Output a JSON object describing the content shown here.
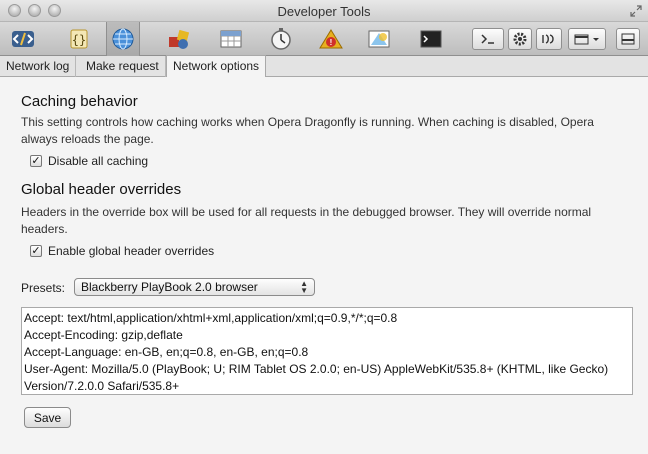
{
  "window": {
    "title": "Developer Tools"
  },
  "toolbar": {
    "panels": [
      {
        "icon": "dom-inspector-icon"
      },
      {
        "icon": "scripts-icon"
      },
      {
        "icon": "network-icon",
        "active": true
      },
      {
        "icon": "resources-icon"
      },
      {
        "icon": "storage-icon"
      },
      {
        "icon": "profiler-icon"
      },
      {
        "icon": "errors-icon"
      },
      {
        "icon": "utilities-icon"
      },
      {
        "icon": "console-icon"
      }
    ],
    "right_buttons": [
      "command-line-icon",
      "settings-icon",
      "remote-debug-icon",
      "window-layout-icon",
      "dock-icon"
    ]
  },
  "tabs": [
    "Network log",
    "Make request",
    "Network options"
  ],
  "caching": {
    "heading": "Caching behavior",
    "description": "This setting controls how caching works when Opera Dragonfly is running. When caching is disabled, Opera always reloads the page.",
    "checkbox_label": "Disable all caching",
    "checked": true
  },
  "overrides": {
    "heading": "Global header overrides",
    "description": "Headers in the override box will be used for all requests in the debugged browser. They will override normal headers.",
    "checkbox_label": "Enable global header overrides",
    "checked": true,
    "presets_label": "Presets:",
    "preset_selected": "Blackberry PlayBook 2.0 browser",
    "header_lines": [
      "Accept: text/html,application/xhtml+xml,application/xml;q=0.9,*/*;q=0.8",
      "Accept-Encoding: gzip,deflate",
      "Accept-Language: en-GB, en;q=0.8, en-GB, en;q=0.8",
      "User-Agent: Mozilla/5.0 (PlayBook; U; RIM Tablet OS 2.0.0; en-US) AppleWebKit/535.8+ (KHTML, like Gecko)",
      "Version/7.2.0.0 Safari/535.8+"
    ],
    "save_label": "Save"
  }
}
